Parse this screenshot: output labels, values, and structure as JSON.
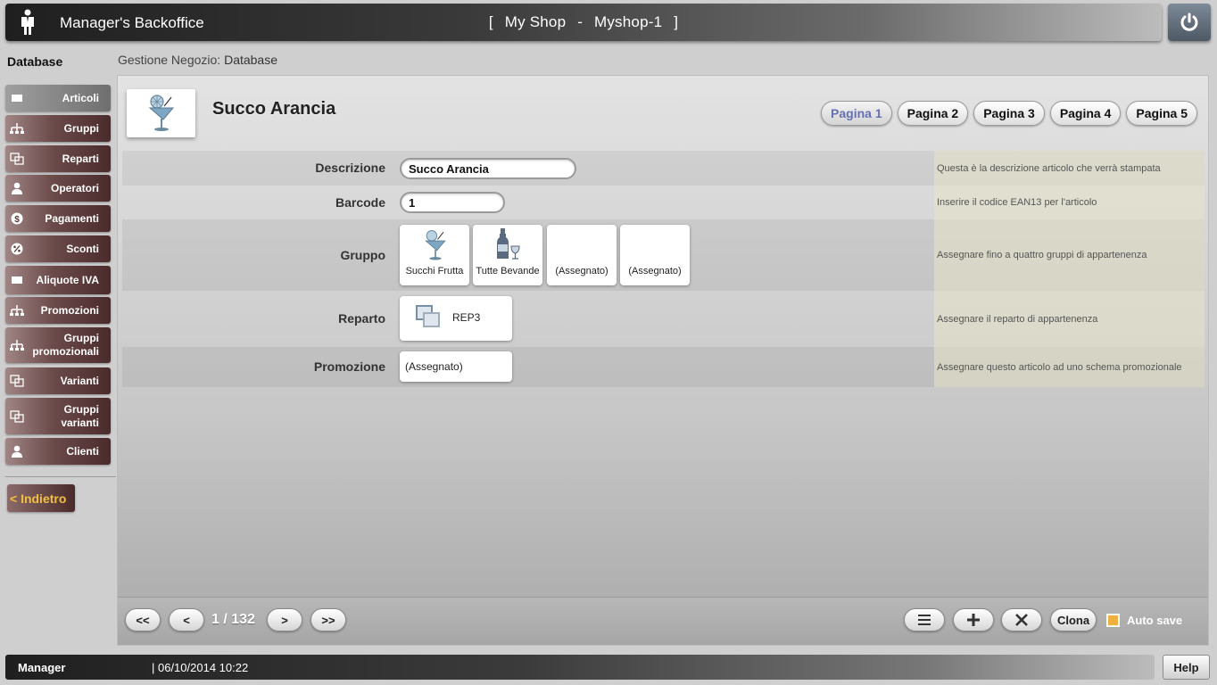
{
  "header": {
    "app_title": "Manager's Backoffice",
    "bracket_open": "[",
    "shop_name": "My Shop",
    "separator": "-",
    "shop_id": "Myshop-1",
    "bracket_close": "]"
  },
  "sidebar": {
    "title": "Database",
    "items": [
      {
        "label": "Articoli",
        "icon": "rectangle-icon"
      },
      {
        "label": "Gruppi",
        "icon": "hierarchy-icon"
      },
      {
        "label": "Reparti",
        "icon": "windows-icon"
      },
      {
        "label": "Operatori",
        "icon": "person-icon"
      },
      {
        "label": "Pagamenti",
        "icon": "dollar-icon"
      },
      {
        "label": "Sconti",
        "icon": "discount-icon"
      },
      {
        "label": "Aliquote IVA",
        "icon": "rectangle-icon"
      },
      {
        "label": "Promozioni",
        "icon": "hierarchy-icon"
      },
      {
        "label": "Gruppi promozionali",
        "icon": "hierarchy-icon"
      },
      {
        "label": "Varianti",
        "icon": "windows-icon"
      },
      {
        "label": "Gruppi varianti",
        "icon": "windows-icon"
      },
      {
        "label": "Clienti",
        "icon": "person-icon"
      }
    ],
    "back_label": "< Indietro"
  },
  "breadcrumb": {
    "prefix": "Gestione Negozio:",
    "current": "Database"
  },
  "item": {
    "title": "Succo Arancia",
    "icon": "cocktail-icon"
  },
  "page_tabs": [
    "Pagina 1",
    "Pagina 2",
    "Pagina 3",
    "Pagina 4",
    "Pagina 5"
  ],
  "form": {
    "descrizione": {
      "label": "Descrizione",
      "value": "Succo Arancia",
      "hint": "Questa è la descrizione articolo che verrà stampata"
    },
    "barcode": {
      "label": "Barcode",
      "value": "1",
      "hint": "Inserire il codice EAN13 per l'articolo"
    },
    "gruppo": {
      "label": "Gruppo",
      "hint": "Assegnare fino a quattro gruppi di appartenenza",
      "cards": [
        {
          "caption": "Succhi Frutta",
          "icon": "cocktail-icon"
        },
        {
          "caption": "Tutte Bevande",
          "icon": "bottle-glass-icon"
        },
        {
          "caption": "(Assegnato)",
          "icon": ""
        },
        {
          "caption": "(Assegnato)",
          "icon": ""
        }
      ]
    },
    "reparto": {
      "label": "Reparto",
      "value": "REP3",
      "icon": "windows-icon",
      "hint": "Assegnare il reparto di appartenenza"
    },
    "promozione": {
      "label": "Promozione",
      "value": "(Assegnato)",
      "hint": "Assegnare questo articolo ad uno schema promozionale"
    }
  },
  "footer": {
    "first": "<<",
    "prev": "<",
    "page_indicator": "1 / 132",
    "next": ">",
    "last": ">>",
    "list_icon": "list-icon",
    "add_icon": "plus-icon",
    "delete_icon": "x-icon",
    "clone": "Clona",
    "autosave": "Auto save",
    "autosave_checked": true
  },
  "status": {
    "user": "Manager",
    "datetime": "| 06/10/2014 10:22",
    "help": "Help"
  }
}
